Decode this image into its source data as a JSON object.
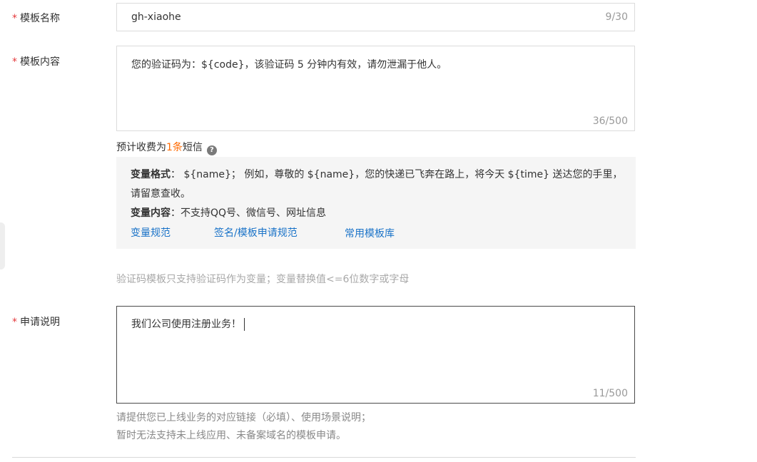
{
  "fields": {
    "template_name": {
      "label": "模板名称",
      "required_mark": "*",
      "value": "gh-xiaohe",
      "counter": "9/30"
    },
    "template_content": {
      "label": "模板内容",
      "required_mark": "*",
      "value": "您的验证码为：${code}，该验证码 5 分钟内有效，请勿泄漏于他人。",
      "counter": "36/500"
    },
    "application_note": {
      "label": "申请说明",
      "required_mark": "*",
      "value": "我们公司使用注册业务！",
      "counter": "11/500"
    }
  },
  "fee": {
    "prefix": "预计收费为",
    "count": "1条",
    "suffix": "短信",
    "help_glyph": "?"
  },
  "variable_info": {
    "format_label": "变量格式",
    "format_text_1": "： ${name}； 例如，尊敬的 ${name}，您的快递已飞奔在路上，将今天 ${time} 送达您的手里，",
    "format_text_2": "请留意查收。",
    "content_label": "变量内容",
    "content_text": "：不支持QQ号、微信号、网址信息",
    "links": [
      "变量规范",
      "签名/模板申请规范",
      "常用模板库"
    ]
  },
  "hints": {
    "code_template": "验证码模板只支持验证码作为变量；变量替换值<=6位数字或字母",
    "note_line_1": "请提供您已上线业务的对应链接（必填）、使用场景说明；",
    "note_line_2": "暂时无法支持未上线应用、未备案域名的模板申请。"
  },
  "colors": {
    "required": "#e4393c",
    "fee_highlight": "#ff6a00",
    "link": "#1a73c8",
    "info_bg": "#f5f5f5"
  }
}
